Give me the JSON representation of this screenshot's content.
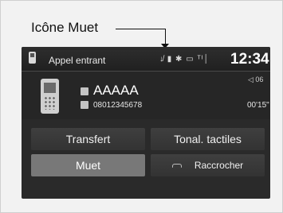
{
  "callout": {
    "label": "Icône Muet"
  },
  "header": {
    "title": "Appel entrant",
    "status_icons": "↓̸ ▮ ✱ ▭ ᵀᴵ│",
    "clock": "12:34"
  },
  "call": {
    "contact_name": "AAAAA",
    "phone_number": "08012345678",
    "volume_level": "◁ 06",
    "duration": "00'15\""
  },
  "buttons": {
    "transfer": "Transfert",
    "dtmf": "Tonal. tactiles",
    "mute": "Muet",
    "hangup": "Raccrocher"
  }
}
